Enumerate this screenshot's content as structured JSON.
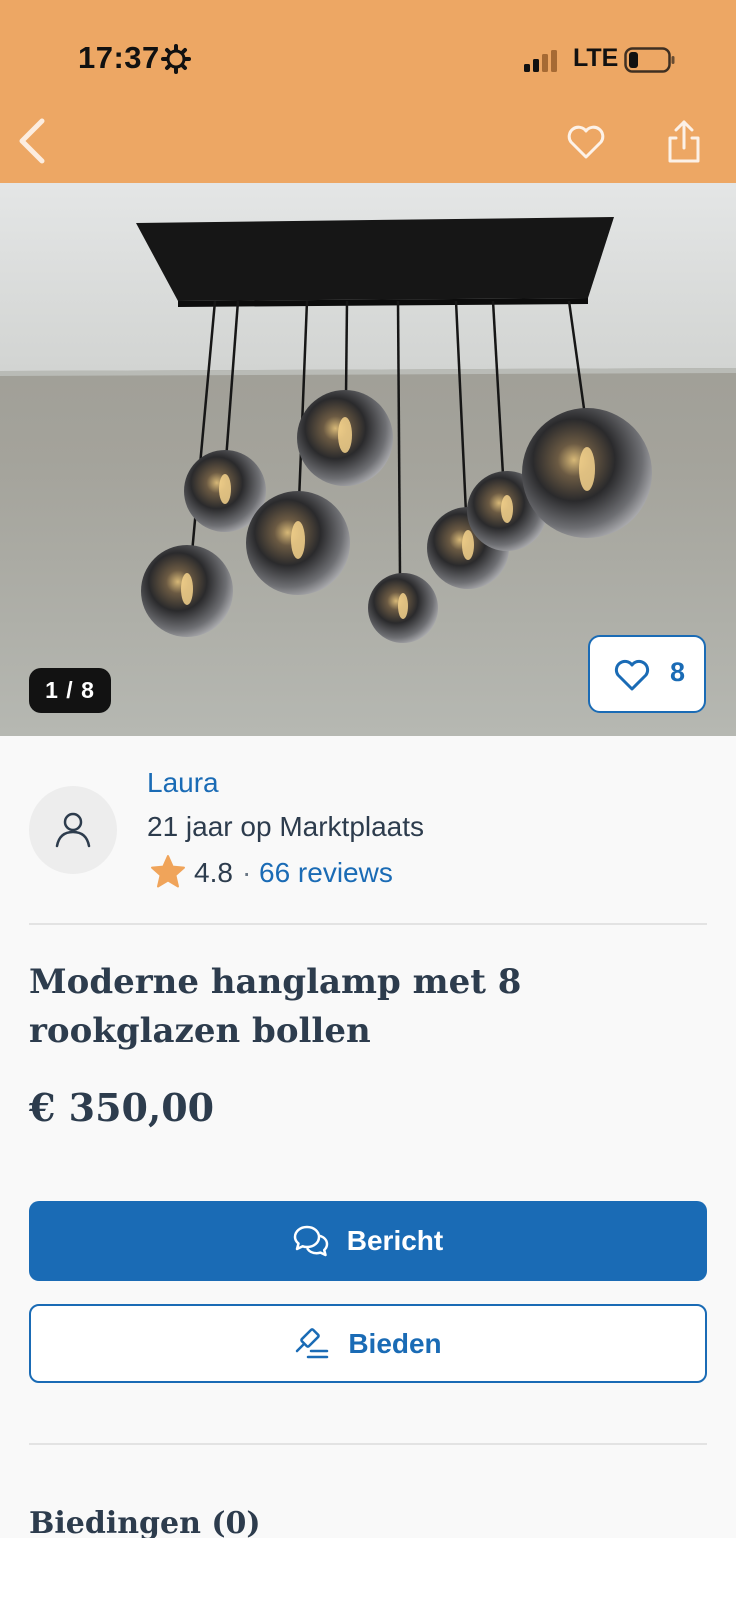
{
  "status_bar": {
    "time": "17:37",
    "network": "LTE"
  },
  "header": {
    "back_icon": "chevron-left-icon",
    "favorite_icon": "heart-outline-icon",
    "share_icon": "share-icon"
  },
  "gallery": {
    "counter": "1 / 8",
    "like_count": "8"
  },
  "seller": {
    "name": "Laura",
    "member_since": "21 jaar op Marktplaats",
    "rating": "4.8",
    "separator": "·",
    "reviews": "66 reviews"
  },
  "listing": {
    "title": "Moderne hanglamp met 8 rookglazen bollen",
    "price": "€ 350,00"
  },
  "actions": {
    "message_label": "Bericht",
    "bid_label": "Bieden"
  },
  "bids": {
    "section_title": "Biedingen (0)"
  },
  "colors": {
    "header": "#eda764",
    "accent": "#1a6bb5",
    "text": "#2d3c4d",
    "star": "#f0a45a"
  }
}
